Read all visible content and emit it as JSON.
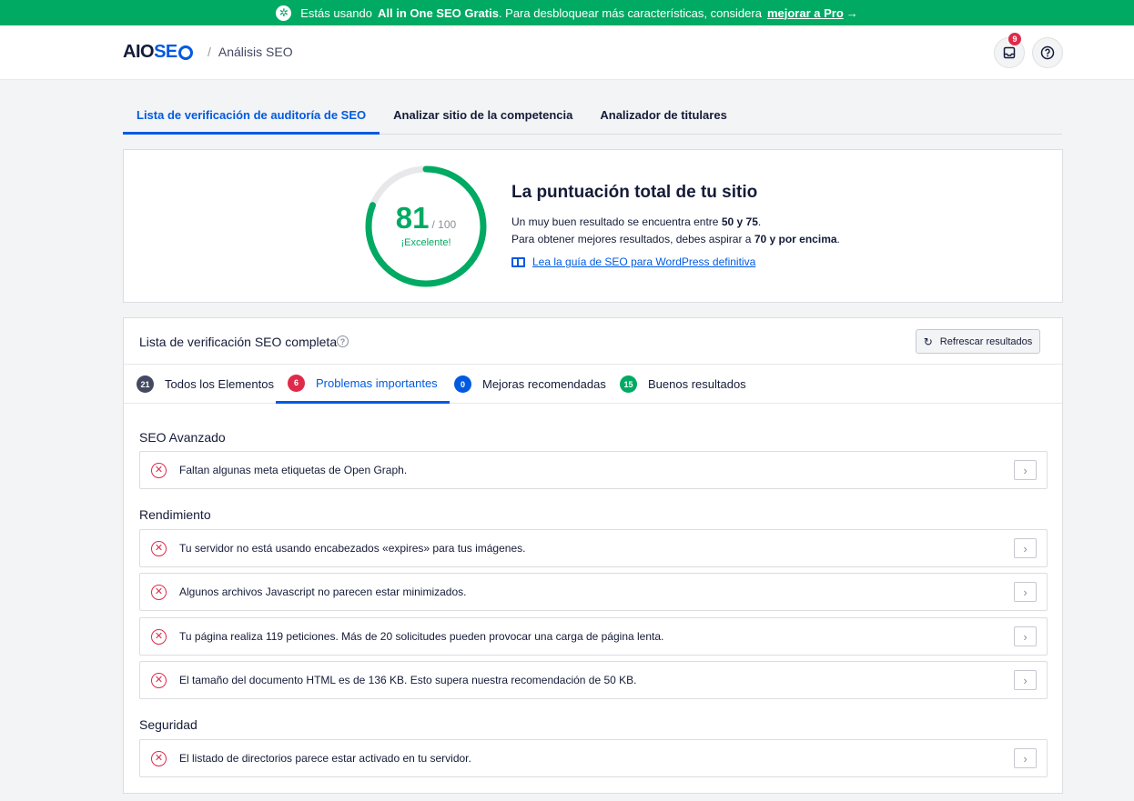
{
  "promo": {
    "pre": "Estás usando",
    "bold": "All in One SEO Gratis",
    "mid": ". Para desbloquear más características, considera",
    "link": "mejorar a Pro",
    "arrow": "→"
  },
  "header": {
    "logo_aio": "AIO",
    "logo_seo": "SE",
    "separator": "/",
    "breadcrumb": "Análisis SEO",
    "notifications_count": "9"
  },
  "tabs": [
    {
      "label": "Lista de verificación de auditoría de SEO",
      "active": true
    },
    {
      "label": "Analizar sitio de la competencia",
      "active": false
    },
    {
      "label": "Analizador de titulares",
      "active": false
    }
  ],
  "score": {
    "value": "81",
    "max": "/ 100",
    "fraction": 0.81,
    "label": "¡Excelente!",
    "title": "La puntuación total de tu sitio",
    "line1_pre": "Un muy buen resultado se encuentra entre",
    "line1_bold": "50 y 75",
    "line1_post": ".",
    "line2_pre": "Para obtener mejores resultados, debes aspirar a",
    "line2_bold": "70 y por encima",
    "line2_post": ".",
    "guide_link": "Lea la guía de SEO para WordPress definitiva"
  },
  "checklist": {
    "title": "Lista de verificación SEO completa",
    "refresh_label": "Refrescar resultados",
    "subtabs": [
      {
        "count": "21",
        "label": "Todos los Elementos",
        "color": "#434960",
        "active": false
      },
      {
        "count": "6",
        "label": "Problemas importantes",
        "color": "#df2a4a",
        "active": true
      },
      {
        "count": "0",
        "label": "Mejoras recomendadas",
        "color": "#005ae0",
        "active": false
      },
      {
        "count": "15",
        "label": "Buenos resultados",
        "color": "#00aa63",
        "active": false
      }
    ],
    "sections": [
      {
        "label": "SEO Avanzado",
        "items": [
          "Faltan algunas meta etiquetas de Open Graph."
        ]
      },
      {
        "label": "Rendimiento",
        "items": [
          "Tu servidor no está usando encabezados «expires» para tus imágenes.",
          "Algunos archivos Javascript no parecen estar minimizados.",
          "Tu página realiza 119 peticiones. Más de 20 solicitudes pueden provocar una carga de página lenta.",
          "El tamaño del documento HTML es de 136 KB. Esto supera nuestra recomendación de 50 KB."
        ]
      },
      {
        "label": "Seguridad",
        "items": [
          "El listado de directorios parece estar activado en tu servidor."
        ]
      }
    ]
  }
}
